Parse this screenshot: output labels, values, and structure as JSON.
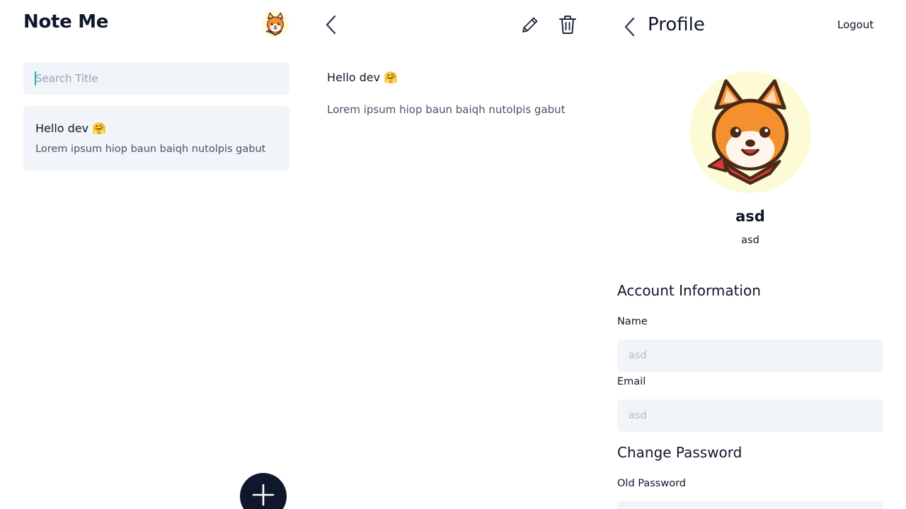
{
  "list_screen": {
    "app_title": "Note Me",
    "search": {
      "placeholder": "Search Title",
      "value": ""
    },
    "notes": [
      {
        "title": "Hello dev 🤗",
        "body": "Lorem ipsum hiop baun baiqh nutolpis gabut"
      }
    ],
    "fab_icon": "plus-icon",
    "avatar_icon": "shiba-dog-avatar-icon"
  },
  "detail_screen": {
    "back_icon": "chevron-left-icon",
    "edit_icon": "pencil-icon",
    "delete_icon": "trash-icon",
    "title": "Hello dev 🤗",
    "body": "Lorem ipsum hiop baun baiqh nutolpis gabut"
  },
  "profile_screen": {
    "back_icon": "chevron-left-icon",
    "title": "Profile",
    "logout_label": "Logout",
    "avatar_icon": "shiba-dog-avatar-icon",
    "user_name": "asd",
    "user_email": "asd",
    "account_heading": "Account Information",
    "name_label": "Name",
    "name_placeholder": "asd",
    "email_label": "Email",
    "email_placeholder": "asd",
    "password_heading": "Change Password",
    "old_password_label": "Old Password",
    "old_password_placeholder": ""
  },
  "colors": {
    "primary": "#0f172a",
    "surface": "#f1f4f8",
    "muted_text": "#475569",
    "placeholder": "#94a3b8",
    "avatar_bg": "#fdfad6",
    "caret": "#14b8a6"
  }
}
